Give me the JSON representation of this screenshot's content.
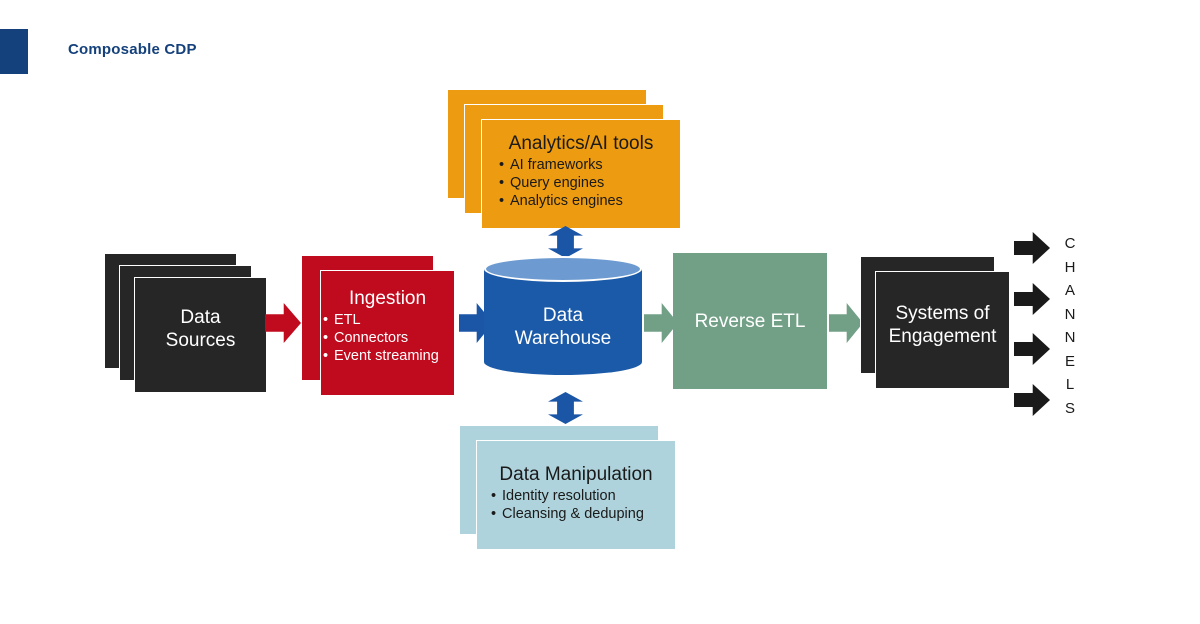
{
  "header": {
    "title": "Composable CDP",
    "brand_color": "#14417B"
  },
  "colors": {
    "dark": "#262626",
    "red": "#C00A1E",
    "orange": "#ED9B10",
    "light_blue": "#AFD3DC",
    "warehouse_blue": "#1B5AA8",
    "warehouse_top_blue": "#6D9BD1",
    "green": "#72A086",
    "arrow_blue": "#1B55A5",
    "arrow_black": "#1A1A1A"
  },
  "nodes": {
    "data_sources": {
      "title": "Data\nSources",
      "title_line1": "Data",
      "title_line2": "Sources",
      "stack_count": 3
    },
    "ingestion": {
      "title": "Ingestion",
      "bullets": [
        "ETL",
        "Connectors",
        "Event streaming"
      ],
      "stack_count": 2
    },
    "analytics_ai_tools": {
      "title": "Analytics/AI tools",
      "bullets": [
        "AI frameworks",
        "Query engines",
        "Analytics engines"
      ],
      "stack_count": 3
    },
    "data_warehouse": {
      "title_line1": "Data",
      "title_line2": "Warehouse"
    },
    "data_manipulation": {
      "title": "Data Manipulation",
      "bullets": [
        "Identity resolution",
        "Cleansing & deduping"
      ],
      "stack_count": 2
    },
    "reverse_etl": {
      "title": "Reverse ETL"
    },
    "systems_of_engagement": {
      "title_line1": "Systems of",
      "title_line2": "Engagement",
      "stack_count": 2
    },
    "channels": {
      "label": "CHANNELS",
      "letters": [
        "C",
        "H",
        "A",
        "N",
        "N",
        "E",
        "L",
        "S"
      ],
      "arrow_count": 4
    }
  },
  "connectors": [
    {
      "name": "sources-to-ingestion",
      "direction": "right",
      "color": "#C00A1E"
    },
    {
      "name": "ingestion-to-warehouse",
      "direction": "right",
      "color": "#1B55A5"
    },
    {
      "name": "warehouse-to-analytics",
      "direction": "up-down",
      "color": "#1B55A5"
    },
    {
      "name": "warehouse-to-manipulation",
      "direction": "up-down",
      "color": "#1B55A5"
    },
    {
      "name": "warehouse-to-reverse-etl",
      "direction": "right",
      "color": "#72A086"
    },
    {
      "name": "reverse-etl-to-systems",
      "direction": "right",
      "color": "#72A086"
    }
  ]
}
